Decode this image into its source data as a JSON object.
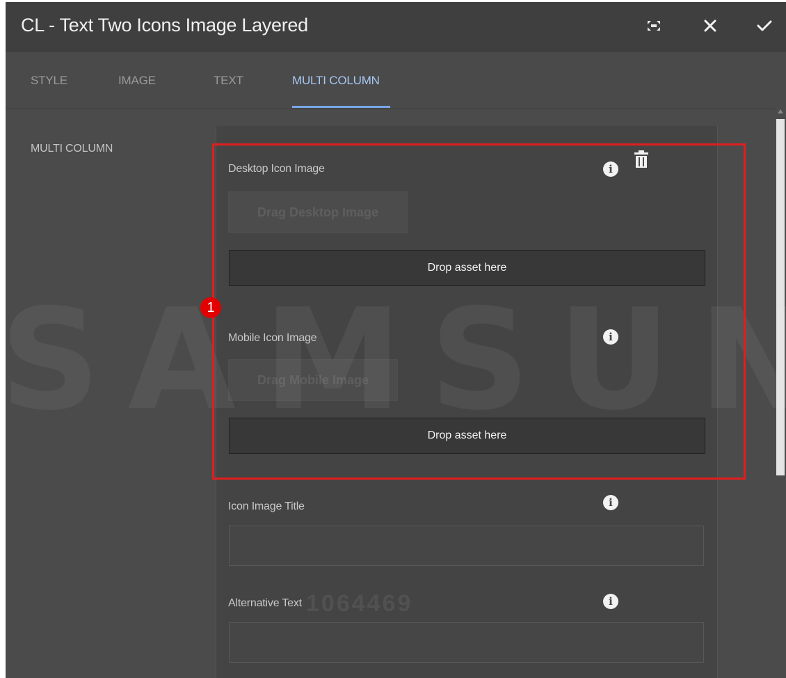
{
  "dialog": {
    "title": "CL - Text Two Icons Image Layered",
    "actions": [
      {
        "name": "fullscreen",
        "icon": "fullscreen-icon"
      },
      {
        "name": "close",
        "icon": "close-icon"
      },
      {
        "name": "confirm",
        "icon": "checkmark-icon"
      }
    ]
  },
  "tabs": [
    {
      "label": "STYLE",
      "active": false
    },
    {
      "label": "IMAGE",
      "active": false
    },
    {
      "label": "TEXT",
      "active": false
    },
    {
      "label": "MULTI COLUMN",
      "active": true
    }
  ],
  "section": {
    "label": "MULTI COLUMN"
  },
  "fields": {
    "desktop_icon": {
      "label": "Desktop Icon Image",
      "drag_label": "Drag Desktop Image",
      "drop_label": "Drop asset here"
    },
    "mobile_icon": {
      "label": "Mobile Icon Image",
      "drag_label": "Drag Mobile Image",
      "drop_label": "Drop asset here"
    },
    "icon_title": {
      "label": "Icon Image Title",
      "value": ""
    },
    "alt_text": {
      "label": "Alternative Text",
      "value": ""
    }
  },
  "annotation": {
    "badge": "1"
  },
  "watermark": {
    "brand": "SAMSUNG",
    "number": "1064469"
  },
  "colors": {
    "background": "#4b4b4b",
    "active_tab": "#a7c8f5",
    "highlight": "#e01e1e",
    "badge": "#e20000"
  }
}
